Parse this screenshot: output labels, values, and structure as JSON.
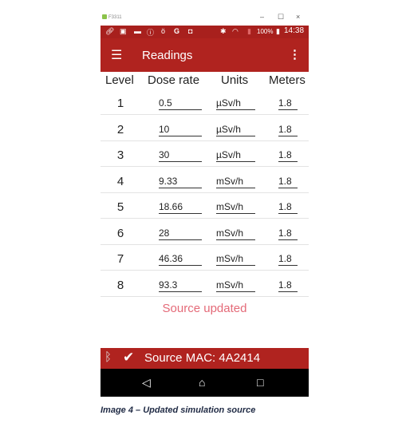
{
  "window": {
    "title": "F3311",
    "minimize": "–",
    "maximize": "☐",
    "close": "×"
  },
  "status_bar": {
    "icons": [
      "link-icon",
      "sim-icon",
      "message-icon",
      "info-icon",
      "bulb-icon",
      "google-icon",
      "android-icon",
      "bluetooth-icon",
      "wifi-icon",
      "alert-battery-icon"
    ],
    "battery": "100%",
    "time": "14:38"
  },
  "app_bar": {
    "title": "Readings"
  },
  "table": {
    "headers": [
      "Level",
      "Dose rate",
      "Units",
      "Meters"
    ],
    "rows": [
      {
        "level": "1",
        "dose": "0.5",
        "unit": "µSv/h",
        "meters": "1.8"
      },
      {
        "level": "2",
        "dose": "10",
        "unit": "µSv/h",
        "meters": "1.8"
      },
      {
        "level": "3",
        "dose": "30",
        "unit": "µSv/h",
        "meters": "1.8"
      },
      {
        "level": "4",
        "dose": "9.33",
        "unit": "mSv/h",
        "meters": "1.8"
      },
      {
        "level": "5",
        "dose": "18.66",
        "unit": "mSv/h",
        "meters": "1.8"
      },
      {
        "level": "6",
        "dose": "28",
        "unit": "mSv/h",
        "meters": "1.8"
      },
      {
        "level": "7",
        "dose": "46.36",
        "unit": "mSv/h",
        "meters": "1.8"
      },
      {
        "level": "8",
        "dose": "93.3",
        "unit": "mSv/h",
        "meters": "1.8"
      }
    ]
  },
  "message": "Source updated",
  "bottom_bar": {
    "mac": "Source MAC: 4A2414"
  },
  "caption": "Image 4 – Updated simulation source",
  "colors": {
    "primary": "#b0231f",
    "status": "#a8201d",
    "message": "#e46a78"
  }
}
